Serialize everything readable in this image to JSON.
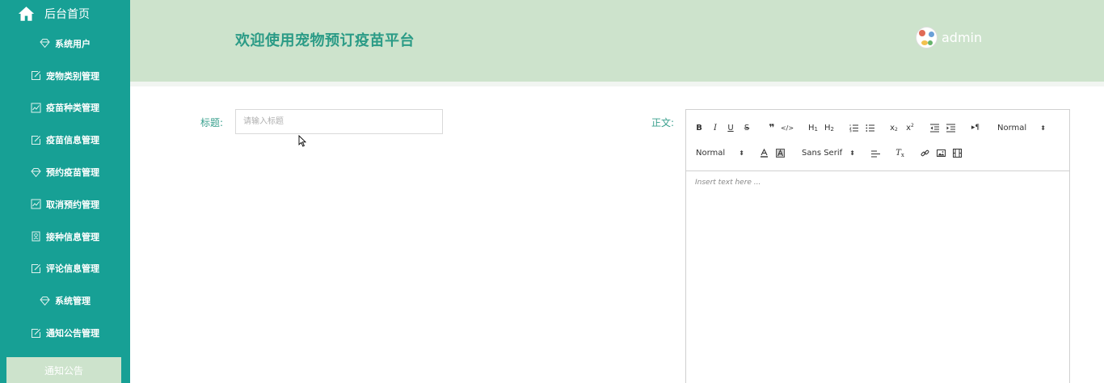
{
  "sidebar": {
    "home_label": "后台首页",
    "items": [
      {
        "label": "系统用户",
        "icon": "diamond-icon"
      },
      {
        "label": "宠物类别管理",
        "icon": "edit-icon"
      },
      {
        "label": "疫苗种类管理",
        "icon": "chart-icon"
      },
      {
        "label": "疫苗信息管理",
        "icon": "edit-icon"
      },
      {
        "label": "预约疫苗管理",
        "icon": "diamond-icon"
      },
      {
        "label": "取消预约管理",
        "icon": "chart-icon"
      },
      {
        "label": "接种信息管理",
        "icon": "badge-icon"
      },
      {
        "label": "评论信息管理",
        "icon": "edit-icon"
      },
      {
        "label": "系统管理",
        "icon": "diamond-icon"
      },
      {
        "label": "通知公告管理",
        "icon": "edit-icon"
      }
    ],
    "sub_item": "通知公告"
  },
  "header": {
    "title": "欢迎使用宠物预订疫苗平台",
    "username": "admin"
  },
  "form": {
    "title_label": "标题:",
    "title_placeholder": "请输入标题",
    "content_label": "正文:",
    "editor": {
      "header_picker": "Normal",
      "size_picker": "Normal",
      "font_picker": "Sans Serif",
      "placeholder": "Insert text here ..."
    }
  },
  "colors": {
    "sidebar_bg": "#17a095",
    "header_bg": "#cde3cc",
    "title_color": "#2b9b86"
  }
}
